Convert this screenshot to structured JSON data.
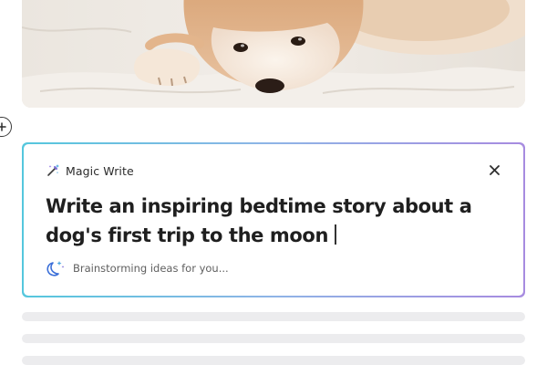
{
  "photo": {
    "subject": "shiba-inu-dog-lying-on-blanket"
  },
  "add_button": {
    "icon": "plus-icon"
  },
  "magic_write": {
    "title": "Magic Write",
    "title_icon": "magic-wand-icon",
    "close_icon": "close-icon",
    "prompt_line1": "Write an inspiring bedtime story about a",
    "prompt_line2": "dog's first trip to the moon",
    "status_icon": "moon-sparkle-icon",
    "status_text": "Brainstorming ideas for you...",
    "colors": {
      "border_start": "#55c7dd",
      "border_mid": "#8fb4e6",
      "border_end": "#a78be0"
    }
  },
  "skeleton_lines": 3
}
